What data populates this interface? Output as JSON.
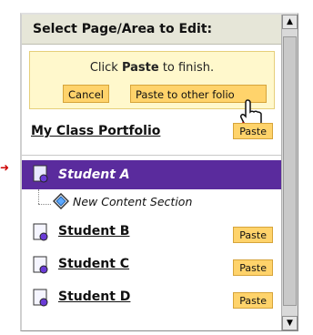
{
  "dialog": {
    "header_title": "Select Page/Area to Edit:",
    "instruction_prefix": "Click",
    "instruction_bold": "Paste",
    "instruction_suffix": "to finish.",
    "cancel_label": "Cancel",
    "paste_other_label": "Paste to other folio"
  },
  "portfolio": {
    "title": "My Class Portfolio",
    "paste_label": "Paste"
  },
  "selected_item": {
    "label": "Student A"
  },
  "child_item": {
    "label": "New Content Section"
  },
  "students": [
    {
      "label": "Student B",
      "paste_label": "Paste"
    },
    {
      "label": "Student C",
      "paste_label": "Paste"
    },
    {
      "label": "Student D",
      "paste_label": "Paste"
    }
  ],
  "icons": {
    "selection_arrow": "right-arrow-icon",
    "page_icon": "page-icon",
    "content_icon": "diamond-content-icon",
    "scroll_up": "scroll-up-icon",
    "scroll_down": "scroll-down-icon",
    "cursor": "hand-cursor-icon"
  },
  "colors": {
    "header_bg": "#e6e6d8",
    "notice_bg": "#fff8cc",
    "button_bg": "#ffd36b",
    "selected_bg": "#5a2b9d"
  }
}
